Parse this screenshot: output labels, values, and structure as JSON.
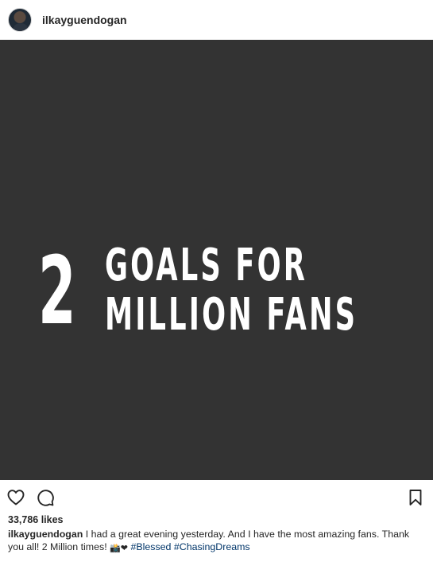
{
  "post": {
    "username": "ilkayguendogan",
    "image": {
      "background": "#333333",
      "text_color": "#ffffff",
      "number": "2",
      "line1": "GOALS FOR",
      "line2": "MILLION FANS"
    },
    "actions": {
      "like_icon": "heart-outline-icon",
      "comment_icon": "comment-bubble-icon",
      "save_icon": "bookmark-icon"
    },
    "likes": "33,786 likes",
    "caption": {
      "username": "ilkayguendogan",
      "text": " I had a great evening yesterday. And I have the most amazing fans. Thank you all! 2 Million times! ",
      "emojis": "📸❤",
      "hashtag1": "#Blessed",
      "hashtag2": "#ChasingDreams"
    },
    "colors": {
      "hashtag": "#003569",
      "heart": "#d3172b"
    }
  }
}
